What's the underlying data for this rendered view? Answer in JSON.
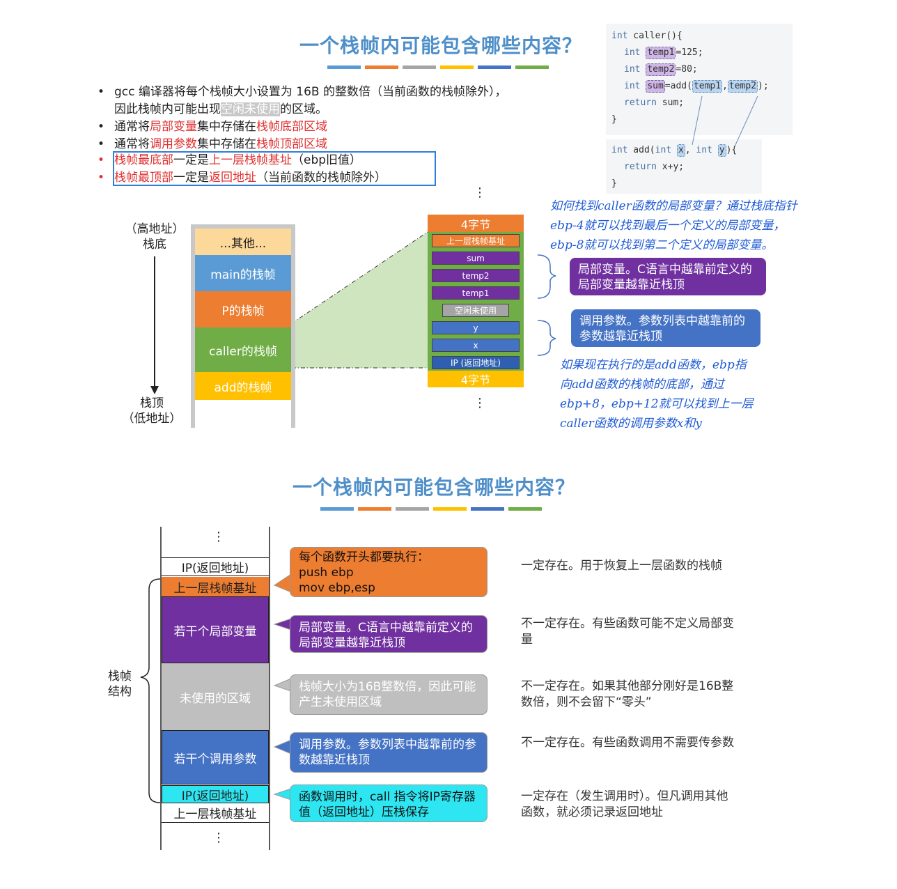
{
  "section1": {
    "title": "一个栈帧内可能包含哪些内容？",
    "bar_colors": [
      "#5b9bd5",
      "#ed7d31",
      "#a5a5a5",
      "#ffc000",
      "#4472c4",
      "#70ad47"
    ],
    "bullets": {
      "b1_a": "gcc 编译器将每个栈帧大小设置为 16B 的整数倍（当前函数的栈帧除外），",
      "b1_b1": "因此栈帧内可能出现",
      "b1_hl": "空闲未使用",
      "b1_b2": "的区域。",
      "b2_a": "通常将",
      "b2_r1": "局部变量",
      "b2_b": "集中存储在",
      "b2_r2": "栈帧底部区域",
      "b3_a": "通常将",
      "b3_r1": "调用参数",
      "b3_b": "集中存储在",
      "b3_r2": "栈帧顶部区域",
      "b4_r1": "栈帧最底部",
      "b4_a": "一定是",
      "b4_r2": "上一层栈帧基址",
      "b4_b": "（ebp旧值）",
      "b5_r1": "栈帧最顶部",
      "b5_a": "一定是",
      "b5_r2": "返回地址",
      "b5_b": "（当前函数的栈帧除外）"
    },
    "code_caller": {
      "l1_kw": "int",
      "l1_rest": " caller(){",
      "l2_kw": "int",
      "l2_box": "temp1",
      "l2_rest": "=125;",
      "l3_kw": "int",
      "l3_box": "temp2",
      "l3_rest": "=80;",
      "l4_kw": "int",
      "l4_box": "sum",
      "l4_mid": "=add(",
      "l4_a1": "temp1",
      "l4_comma": ",",
      "l4_a2": "temp2",
      "l4_end": ");",
      "l5_kw": "return",
      "l5_rest": " sum;",
      "l6": "}"
    },
    "code_add": {
      "l1_kw": "int",
      "l1_mid": " add(",
      "l1_kw2": "int",
      "l1_x": "x",
      "l1_comma": ", ",
      "l1_kw3": "int",
      "l1_y": "y",
      "l1_end": "){",
      "l2_kw": "return",
      "l2_rest": " x+y;",
      "l3": "}"
    },
    "labels": {
      "high": "（高地址）\n栈底",
      "low": "栈顶\n（低地址）",
      "vdots": "⋮"
    },
    "stack": [
      "...其他...",
      "main的栈帧",
      "P的栈帧",
      "caller的栈帧",
      "add的栈帧"
    ],
    "detail": {
      "top": "4字节",
      "ebp": "上一层栈帧基址",
      "sum": "sum",
      "temp2": "temp2",
      "temp1": "temp1",
      "unused": "空闲未使用",
      "y": "y",
      "x": "x",
      "ip": "IP (返回地址)",
      "bottom": "4字节"
    },
    "callout_local": "局部变量。C语言中越靠前定义的局部变量越靠近栈顶",
    "callout_param": "调用参数。参数列表中越靠前的参数越靠近栈顶",
    "hand1": [
      "如何找到caller函数的局部变量？通过栈底指针",
      "ebp-4就可以找到最后一个定义的局部变量，",
      "ebp-8就可以找到第二个定义的局部变量。"
    ],
    "hand2": [
      "如果现在执行的是add函数，ebp指",
      "向add函数的栈帧的底部，通过",
      "ebp+8，ebp+12就可以找到上一层",
      "caller函数的调用参数x和y"
    ]
  },
  "section2": {
    "title": "一个栈帧内可能包含哪些内容？",
    "frame_label": "栈帧\n结构",
    "blocks": {
      "ip_top": "IP(返回地址)",
      "ebp": "上一层栈帧基址",
      "locals": "若干个局部变量",
      "unused": "未使用的区域",
      "params": "若干个调用参数",
      "ip": "IP(返回地址)",
      "ebp_bottom": "上一层栈帧基址"
    },
    "callouts": {
      "prologue": [
        "每个函数开头都要执行：",
        "push ebp",
        "mov ebp,esp"
      ],
      "locals": "局部变量。C语言中越靠前定义的局部变量越靠近栈顶",
      "unused": "栈帧大小为16B整数倍，因此可能产生未使用区域",
      "params": "调用参数。参数列表中越靠前的参数越靠近栈顶",
      "ip": "函数调用时，call 指令将IP寄存器值（返回地址）压栈保存"
    },
    "notes": {
      "ebp": "一定存在。用于恢复上一层函数的栈帧",
      "locals": "不一定存在。有些函数可能不定义局部变量",
      "unused": "不一定存在。如果其他部分刚好是16B整数倍，则不会留下“零头”",
      "params": "不一定存在。有些函数调用不需要传参数",
      "ip": "一定存在（发生调用时）。但凡调用其他函数，就必须记录返回地址"
    }
  }
}
